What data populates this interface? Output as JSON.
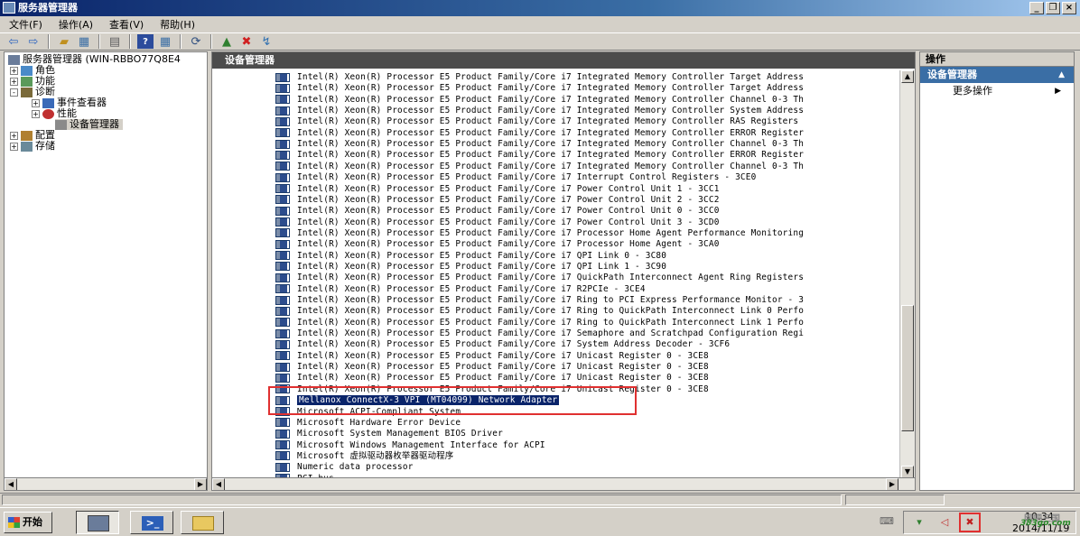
{
  "window": {
    "title": "服务器管理器",
    "controls": [
      "_",
      "❐",
      "×"
    ]
  },
  "menu": [
    "文件(F)",
    "操作(A)",
    "查看(V)",
    "帮助(H)"
  ],
  "tree": {
    "root": "服务器管理器  (WIN-RBBO77Q8E4",
    "items": [
      {
        "label": "角色",
        "expander": "+",
        "indent": 1
      },
      {
        "label": "功能",
        "expander": "+",
        "indent": 1
      },
      {
        "label": "诊断",
        "expander": "-",
        "indent": 1
      },
      {
        "label": "事件查看器",
        "expander": "+",
        "indent": 2
      },
      {
        "label": "性能",
        "expander": "+",
        "indent": 2
      },
      {
        "label": "设备管理器",
        "expander": "",
        "indent": 2,
        "selected": true
      },
      {
        "label": "配置",
        "expander": "+",
        "indent": 1
      },
      {
        "label": "存储",
        "expander": "+",
        "indent": 1
      }
    ]
  },
  "center": {
    "header": "设备管理器",
    "devices": [
      "Intel(R) Xeon(R) Processor E5 Product Family/Core i7 Integrated Memory Controller Target Address",
      "Intel(R) Xeon(R) Processor E5 Product Family/Core i7 Integrated Memory Controller Target Address",
      "Intel(R) Xeon(R) Processor E5 Product Family/Core i7 Integrated Memory Controller Channel 0-3 Th",
      "Intel(R) Xeon(R) Processor E5 Product Family/Core i7 Integrated Memory Controller System Address",
      "Intel(R) Xeon(R) Processor E5 Product Family/Core i7 Integrated Memory Controller RAS Registers",
      "Intel(R) Xeon(R) Processor E5 Product Family/Core i7 Integrated Memory Controller ERROR Register",
      "Intel(R) Xeon(R) Processor E5 Product Family/Core i7 Integrated Memory Controller Channel 0-3 Th",
      "Intel(R) Xeon(R) Processor E5 Product Family/Core i7 Integrated Memory Controller ERROR Register",
      "Intel(R) Xeon(R) Processor E5 Product Family/Core i7 Integrated Memory Controller Channel 0-3 Th",
      "Intel(R) Xeon(R) Processor E5 Product Family/Core i7 Interrupt Control Registers - 3CE0",
      "Intel(R) Xeon(R) Processor E5 Product Family/Core i7 Power Control Unit 1 - 3CC1",
      "Intel(R) Xeon(R) Processor E5 Product Family/Core i7 Power Control Unit 2 - 3CC2",
      "Intel(R) Xeon(R) Processor E5 Product Family/Core i7 Power Control Unit 0 - 3CC0",
      "Intel(R) Xeon(R) Processor E5 Product Family/Core i7 Power Control Unit 3 - 3CD0",
      "Intel(R) Xeon(R) Processor E5 Product Family/Core i7 Processor Home Agent Performance Monitoring",
      "Intel(R) Xeon(R) Processor E5 Product Family/Core i7 Processor Home Agent - 3CA0",
      "Intel(R) Xeon(R) Processor E5 Product Family/Core i7 QPI Link 0 - 3C80",
      "Intel(R) Xeon(R) Processor E5 Product Family/Core i7 QPI Link 1 - 3C90",
      "Intel(R) Xeon(R) Processor E5 Product Family/Core i7 QuickPath Interconnect Agent Ring Registers",
      "Intel(R) Xeon(R) Processor E5 Product Family/Core i7 R2PCIe - 3CE4",
      "Intel(R) Xeon(R) Processor E5 Product Family/Core i7 Ring to PCI Express Performance Monitor - 3",
      "Intel(R) Xeon(R) Processor E5 Product Family/Core i7 Ring to QuickPath Interconnect Link 0 Perfo",
      "Intel(R) Xeon(R) Processor E5 Product Family/Core i7 Ring to QuickPath Interconnect Link 1 Perfo",
      "Intel(R) Xeon(R) Processor E5 Product Family/Core i7 Semaphore and Scratchpad Configuration Regi",
      "Intel(R) Xeon(R) Processor E5 Product Family/Core i7 System Address Decoder - 3CF6",
      "Intel(R) Xeon(R) Processor E5 Product Family/Core i7 Unicast Register 0 - 3CE8",
      "Intel(R) Xeon(R) Processor E5 Product Family/Core i7 Unicast Register 0 - 3CE8",
      "Intel(R) Xeon(R) Processor E5 Product Family/Core i7 Unicast Register 0 - 3CE8",
      "Intel(R) Xeon(R) Processor E5 Product Family/Core i7 Unicast Register 0 - 3CE8",
      "Mellanox ConnectX-3 VPI (MT04099) Network Adapter",
      "Microsoft ACPI-Compliant System",
      "Microsoft Hardware Error Device",
      "Microsoft System Management BIOS Driver",
      "Microsoft Windows Management Interface for ACPI",
      "Microsoft 虚拟驱动器枚举器驱动程序",
      "Numeric data processor",
      "PCI bus"
    ],
    "highlighted_index": 29
  },
  "actions": {
    "header": "操作",
    "section": "设备管理器",
    "items": [
      "更多操作"
    ]
  },
  "taskbar": {
    "start_label": "开始",
    "clock_time": "10:34",
    "clock_date": "2014/11/19"
  },
  "watermark": {
    "line1": "网吧三国",
    "line2": "383go.com"
  },
  "colors": {
    "highlight": "#0a246a",
    "annotation_box": "#e03030",
    "header_bg": "#4c4c4c",
    "actions_section_bg": "#3a6ea5"
  }
}
